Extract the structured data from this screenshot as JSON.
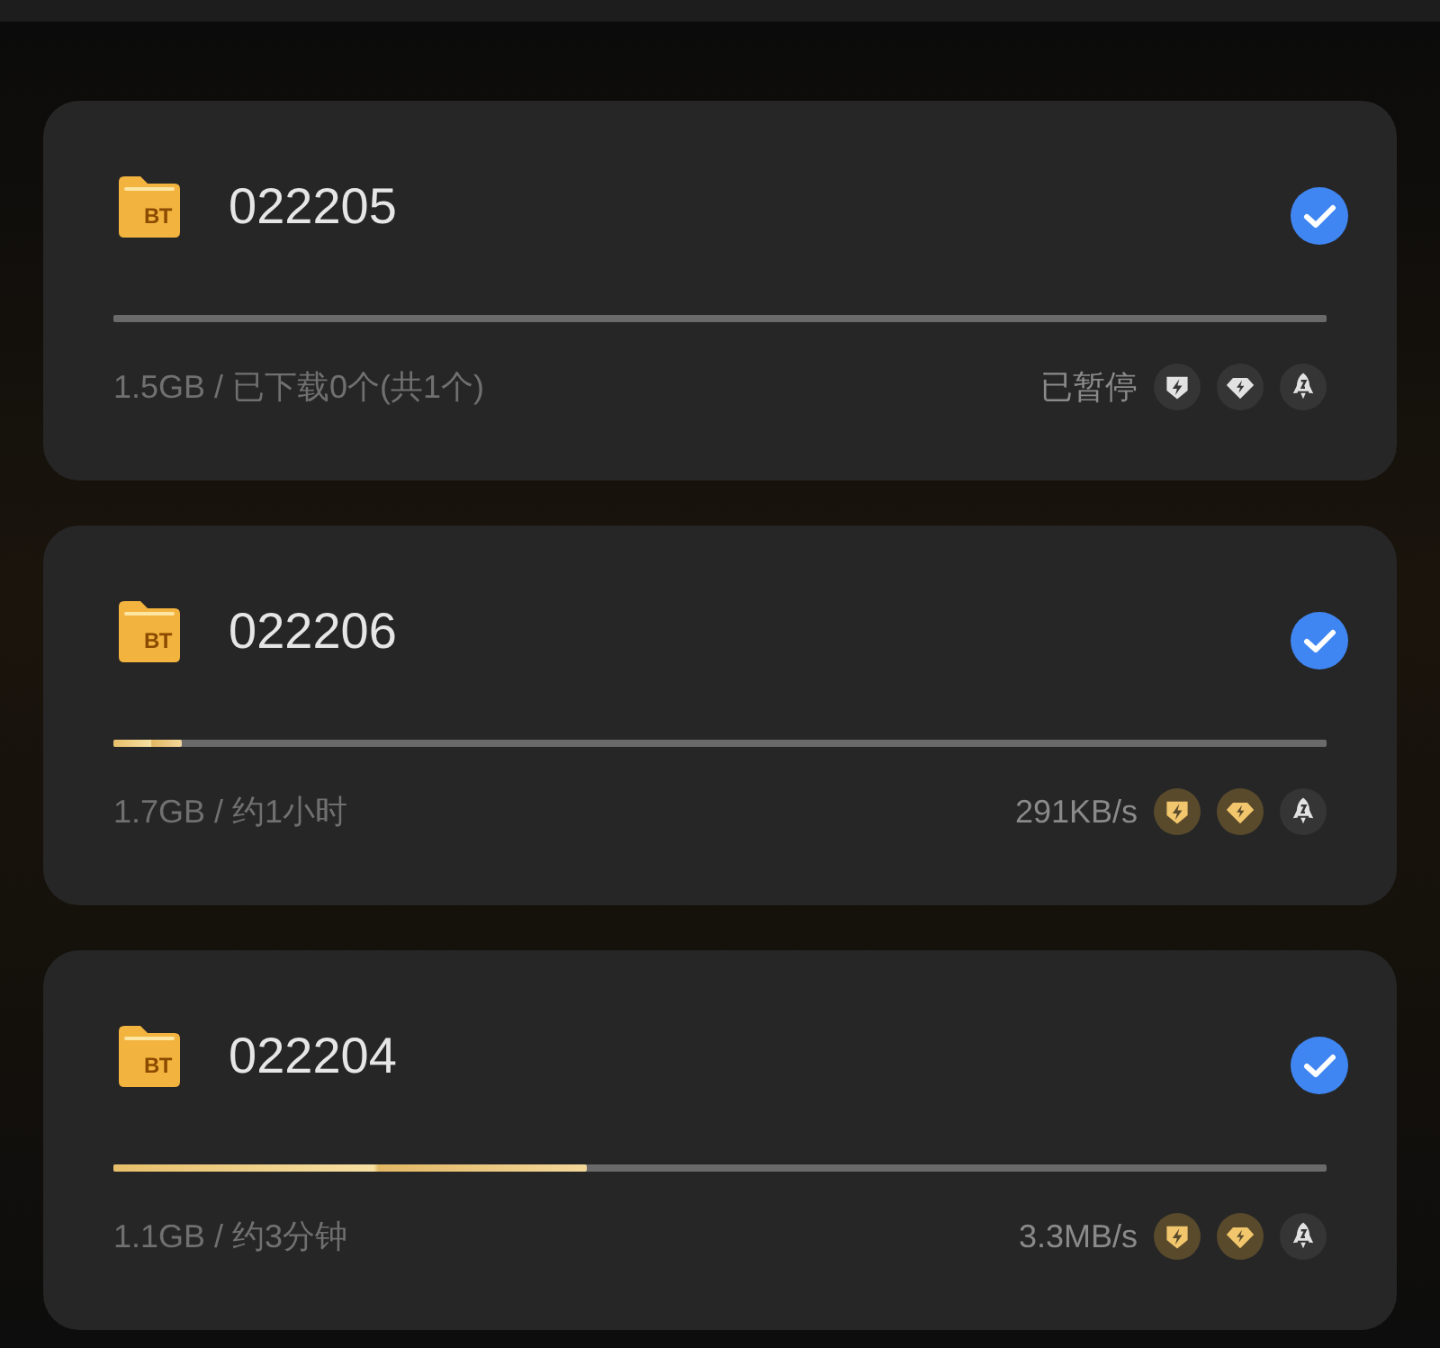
{
  "tasks": [
    {
      "name": "022205",
      "file_type": "BT",
      "selected": true,
      "info": "1.5GB / 已下载0个(共1个)",
      "status": "已暂停",
      "boosts": [
        {
          "kind": "shield",
          "on": false
        },
        {
          "kind": "diamond",
          "on": false
        },
        {
          "kind": "rocket",
          "on": false
        }
      ]
    },
    {
      "name": "022206",
      "file_type": "BT",
      "selected": true,
      "level": 0.056,
      "info": "1.7GB / 约1小时",
      "status": "291KB/s",
      "boosts": [
        {
          "kind": "shield",
          "on": true
        },
        {
          "kind": "diamond",
          "on": true
        },
        {
          "kind": "rocket",
          "on": false
        }
      ]
    },
    {
      "name": "022204",
      "file_type": "BT",
      "selected": true,
      "level": 0.39,
      "info": "1.1GB / 约3分钟",
      "status": "3.3MB/s",
      "boosts": [
        {
          "kind": "shield",
          "on": true
        },
        {
          "kind": "diamond",
          "on": true
        },
        {
          "kind": "rocket",
          "on": false
        }
      ]
    }
  ]
}
